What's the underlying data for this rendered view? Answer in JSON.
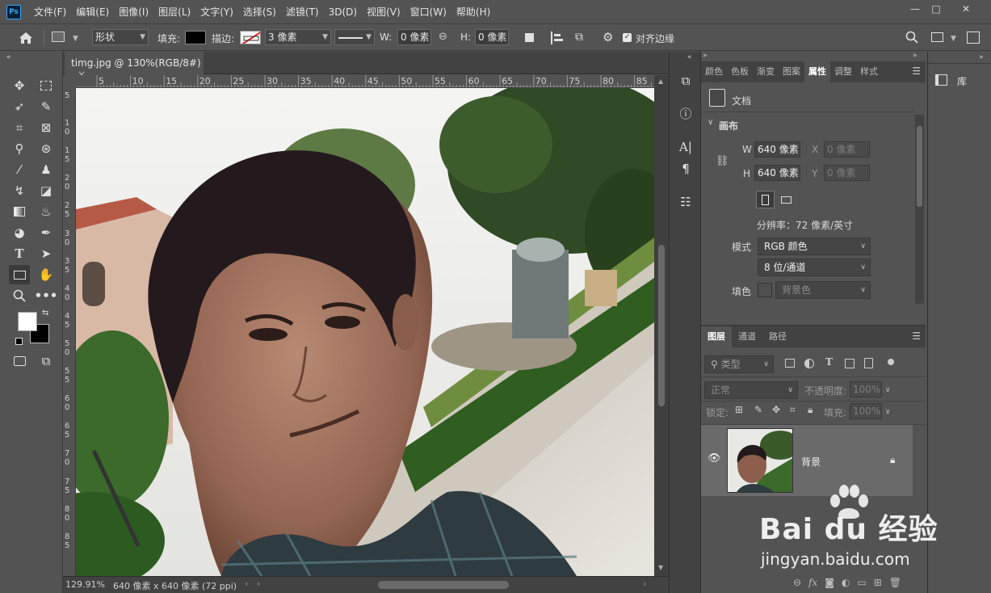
{
  "app": {
    "logo": "Ps"
  },
  "menu": [
    "文件(F)",
    "编辑(E)",
    "图像(I)",
    "图层(L)",
    "文字(Y)",
    "选择(S)",
    "滤镜(T)",
    "3D(D)",
    "视图(V)",
    "窗口(W)",
    "帮助(H)"
  ],
  "window_controls": {
    "minimize": "—",
    "maximize": "□",
    "close": "✕"
  },
  "options": {
    "mode_value": "形状",
    "fill_label": "填充:",
    "stroke_label": "描边:",
    "stroke_width": "3 像素",
    "w_label": "W:",
    "w_value": "0 像素",
    "h_label": "H:",
    "h_value": "0 像素",
    "align_edges_label": "对齐边缘",
    "fill_color": "#000000"
  },
  "document": {
    "tab_title": "timg.jpg @ 130%(RGB/8#)",
    "tab_close": "×",
    "ruler_top": [
      "5",
      "10",
      "15",
      "20",
      "25",
      "30",
      "35",
      "40",
      "45",
      "50",
      "55",
      "60",
      "65",
      "70",
      "75",
      "80",
      "85"
    ],
    "ruler_left": [
      "5",
      "10",
      "15",
      "20",
      "25",
      "30",
      "35",
      "40",
      "45",
      "50",
      "55",
      "60",
      "65",
      "70",
      "75",
      "80",
      "85"
    ],
    "zoom": "129.91%",
    "size_info": "640 像素 x 640 像素 (72 ppi)"
  },
  "properties": {
    "tabs": [
      "颜色",
      "色板",
      "渐变",
      "图案",
      "属性",
      "调整",
      "样式"
    ],
    "active_tab": "属性",
    "doc_label": "文档",
    "section": "画布",
    "w_label": "W",
    "w_value": "640 像素",
    "h_label": "H",
    "h_value": "640 像素",
    "x_label": "X",
    "x_value": "0 像素",
    "y_label": "Y",
    "y_value": "0 像素",
    "resolution": "分辨率：72 像素/英寸",
    "mode_label": "模式",
    "mode_value": "RGB 颜色",
    "depth_value": "8 位/通道",
    "fill_label": "填色",
    "fill_value": "背景色"
  },
  "layers": {
    "tabs": [
      "图层",
      "通道",
      "路径"
    ],
    "filter_placeholder": "类型",
    "blend_mode": "正常",
    "opacity_label": "不透明度:",
    "opacity_value": "100%",
    "lock_label": "锁定:",
    "fill_label": "填充:",
    "fill_value": "100%",
    "layer_name": "背景"
  },
  "library": {
    "label": "库"
  },
  "watermark": {
    "brand": "Bai du 经验",
    "url": "jingyan.baidu.com"
  },
  "colors": {
    "accent": "#31a8ff",
    "panel_bg": "#535353",
    "dark_bg": "#424242"
  }
}
